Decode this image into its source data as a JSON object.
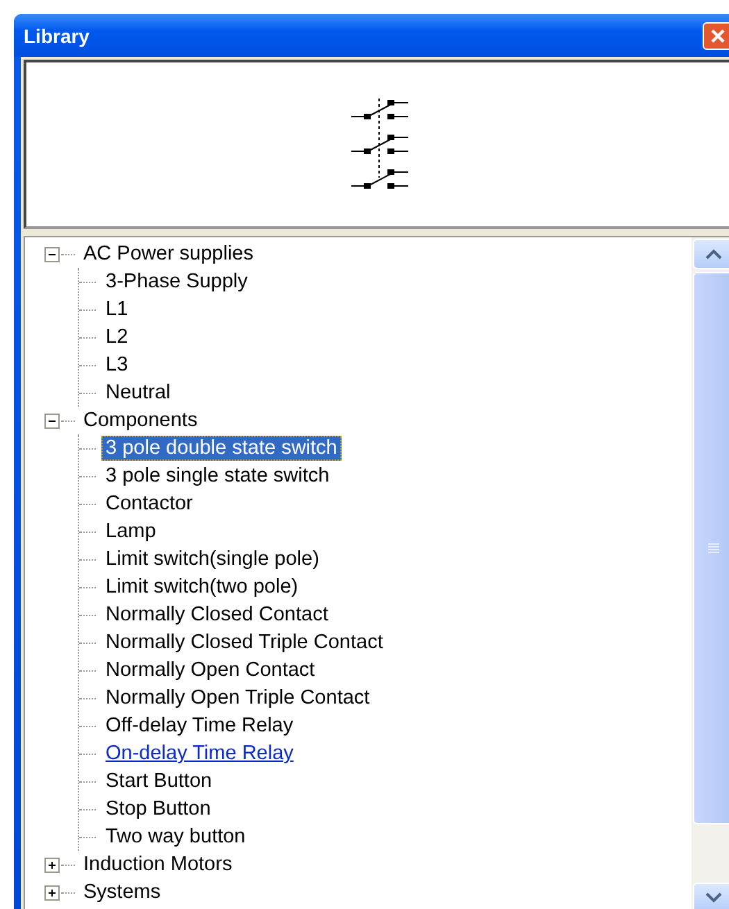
{
  "window": {
    "title": "Library"
  },
  "groups": [
    {
      "label": "AC Power supplies",
      "expanded": true,
      "children": [
        {
          "label": "3-Phase Supply",
          "selected": false,
          "hovered": false
        },
        {
          "label": "L1",
          "selected": false,
          "hovered": false
        },
        {
          "label": "L2",
          "selected": false,
          "hovered": false
        },
        {
          "label": "L3",
          "selected": false,
          "hovered": false
        },
        {
          "label": "Neutral",
          "selected": false,
          "hovered": false
        }
      ]
    },
    {
      "label": "Components",
      "expanded": true,
      "children": [
        {
          "label": "3 pole double state switch",
          "selected": true,
          "hovered": false
        },
        {
          "label": "3 pole single state switch",
          "selected": false,
          "hovered": false
        },
        {
          "label": "Contactor",
          "selected": false,
          "hovered": false
        },
        {
          "label": "Lamp",
          "selected": false,
          "hovered": false
        },
        {
          "label": "Limit switch(single pole)",
          "selected": false,
          "hovered": false
        },
        {
          "label": "Limit switch(two pole)",
          "selected": false,
          "hovered": false
        },
        {
          "label": "Normally Closed Contact",
          "selected": false,
          "hovered": false
        },
        {
          "label": "Normally Closed Triple Contact",
          "selected": false,
          "hovered": false
        },
        {
          "label": "Normally Open Contact",
          "selected": false,
          "hovered": false
        },
        {
          "label": "Normally Open Triple Contact",
          "selected": false,
          "hovered": false
        },
        {
          "label": "Off-delay Time Relay",
          "selected": false,
          "hovered": false
        },
        {
          "label": "On-delay Time Relay",
          "selected": false,
          "hovered": true
        },
        {
          "label": "Start Button",
          "selected": false,
          "hovered": false
        },
        {
          "label": "Stop Button",
          "selected": false,
          "hovered": false
        },
        {
          "label": "Two way button",
          "selected": false,
          "hovered": false
        }
      ]
    },
    {
      "label": "Induction Motors",
      "expanded": false
    },
    {
      "label": "Systems",
      "expanded": false
    }
  ]
}
